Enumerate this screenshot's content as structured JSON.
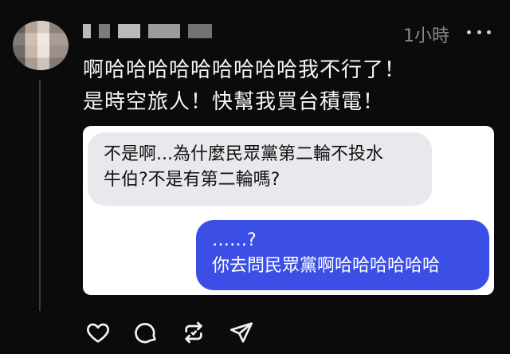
{
  "post": {
    "timestamp": "1小時",
    "text_lines": [
      "啊哈哈哈哈哈哈哈哈哈我不行了！",
      "是時空旅人！快幫我買台積電！"
    ]
  },
  "image": {
    "incoming_message": {
      "lines": [
        "不是啊...為什麼民眾黨第二輪不投水",
        "牛伯?不是有第二輪嗎?"
      ]
    },
    "outgoing_message": {
      "lines": [
        "……?",
        "你去問民眾黨啊哈哈哈哈哈哈"
      ]
    }
  },
  "actions": {
    "icons": [
      "heart-icon",
      "comment-icon",
      "repost-icon",
      "share-icon"
    ]
  },
  "colors": {
    "background": "#0b0b0b",
    "outgoing_bubble": "#3b4fe6",
    "incoming_bubble": "#e9e9ed"
  }
}
